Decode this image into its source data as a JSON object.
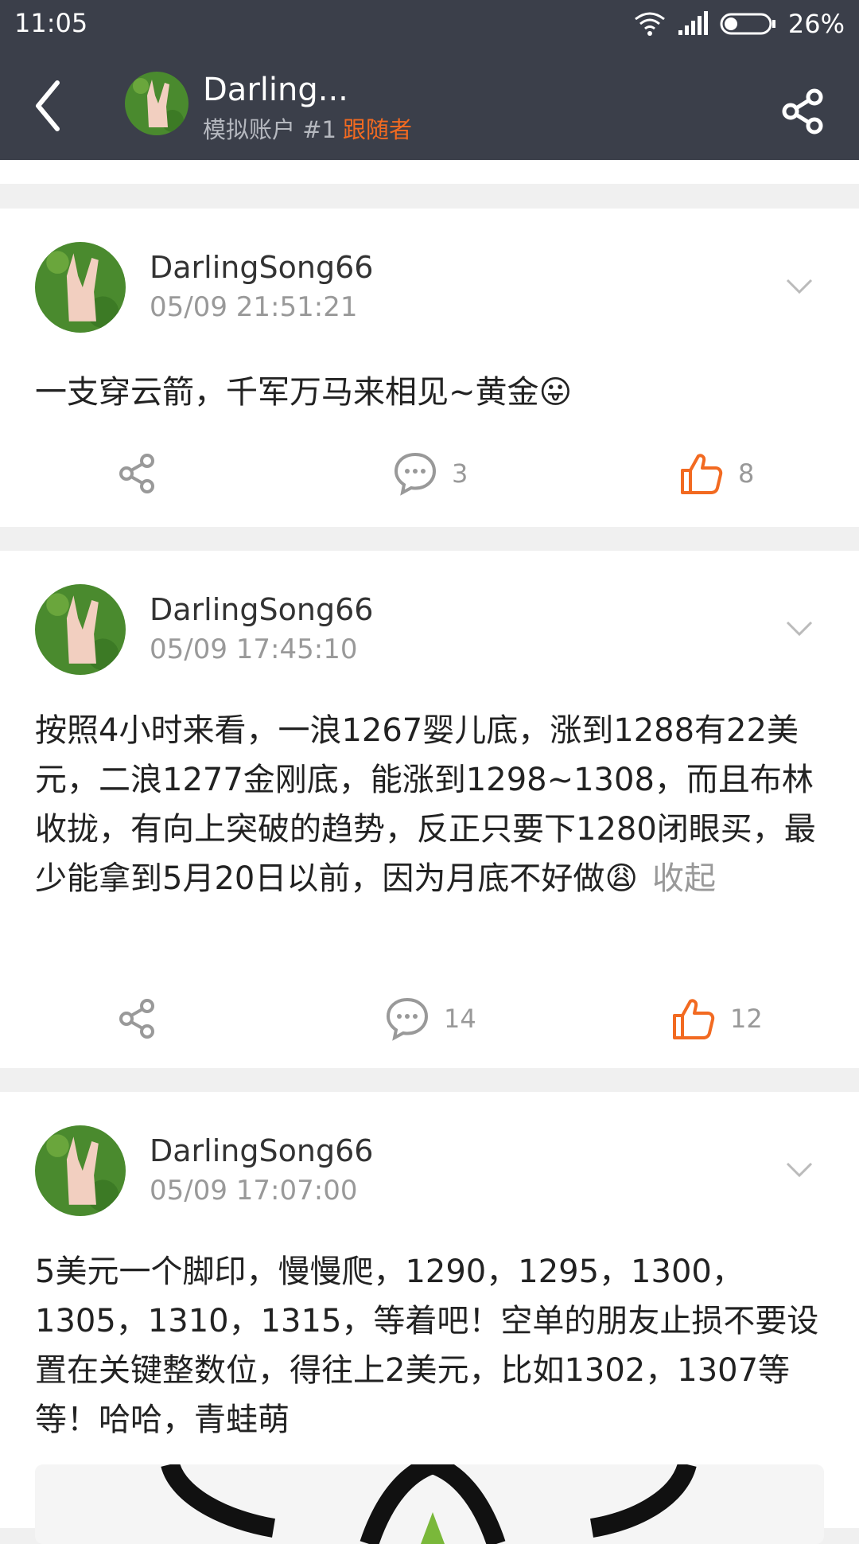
{
  "status": {
    "time": "11:05",
    "battery": "26%"
  },
  "header": {
    "name": "Darling...",
    "subtitle": "模拟账户 #1",
    "follow_label": "跟随者"
  },
  "posts": [
    {
      "author": "DarlingSong66",
      "time": "05/09 21:51:21",
      "text": "一支穿云箭，千军万马来相见~黄金😛",
      "comments": "3",
      "likes": "8"
    },
    {
      "author": "DarlingSong66",
      "time": "05/09 17:45:10",
      "text": "按照4小时来看，一浪1267婴儿底，涨到1288有22美元，二浪1277金刚底，能涨到1298~1308，而且布林收拢，有向上突破的趋势，反正只要下1280闭眼买，最少能拿到5月20日以前，因为月底不好做😩",
      "collapse_label": "收起",
      "comments": "14",
      "likes": "12"
    },
    {
      "author": "DarlingSong66",
      "time": "05/09 17:07:00",
      "text": "5美元一个脚印，慢慢爬，1290，1295，1300，1305，1310，1315，等着吧！空单的朋友止损不要设置在关键整数位，得往上2美元，比如1302，1307等等！哈哈，青蛙萌"
    }
  ],
  "colors": {
    "topbar": "#3b3f4a",
    "accent": "#f26a21"
  },
  "icons": [
    "back-arrow-icon",
    "share-icon",
    "comment-icon",
    "thumbs-up-icon",
    "chevron-down-icon",
    "wifi-icon",
    "signal-icon",
    "battery-icon"
  ]
}
